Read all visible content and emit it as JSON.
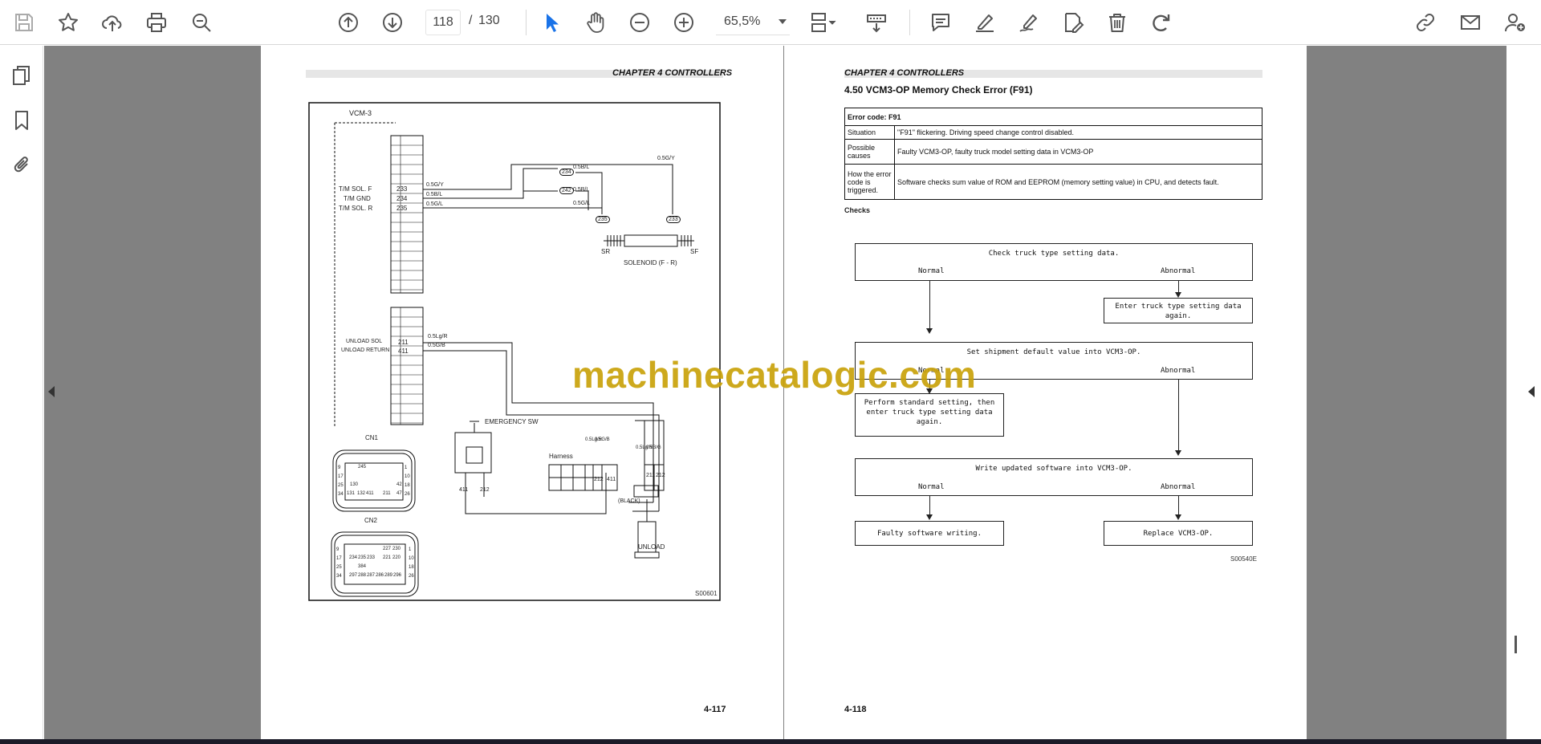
{
  "toolbar": {
    "page_current": "118",
    "page_separator": "/",
    "page_total": "130",
    "zoom": "65,5%",
    "accent": "#1a73e8",
    "icon_color": "#555555"
  },
  "sidebar": {
    "items": [
      "pages-icon",
      "bookmark-icon",
      "attachment-icon"
    ]
  },
  "left_page": {
    "chapter": "CHAPTER 4  CONTROLLERS",
    "page_number": "4-117",
    "figure_code": "S00601",
    "diagram": {
      "connector_label": "VCM-3",
      "rows1": [
        {
          "label": "T/M SOL. F",
          "pin": "233",
          "wire": "0.5G/Y"
        },
        {
          "label": "T/M GND",
          "pin": "234",
          "wire": "0.5B/L"
        },
        {
          "label": "T/M SOL. R",
          "pin": "235",
          "wire": "0.5G/L"
        }
      ],
      "top_wires": [
        "0.5G/Y",
        "0.5B/L",
        "0.5B/L",
        "0.5G/L"
      ],
      "top_pins": [
        "234",
        "242",
        "235",
        "233"
      ],
      "sr": "SR",
      "sf": "SF",
      "solenoid": "SOLENOID (F - R)",
      "rows2": [
        {
          "label": "UNLOAD SOL",
          "pin": "211",
          "wire": "0.5Lg/R"
        },
        {
          "label": "UNLOAD RETURN",
          "pin": "411",
          "wire": "0.5G/B"
        }
      ],
      "emergency": "EMERGENCY SW",
      "harness": "Harness",
      "harness_pins": [
        "212",
        "411"
      ],
      "em_pins": [
        "411",
        "212"
      ],
      "vert_wires": [
        "0.5Lg/R",
        "0.5G/B",
        "0.5Lg/R",
        "0.5B/G"
      ],
      "unload_pins": [
        "211",
        "212"
      ],
      "black": "(BLACK)",
      "unload": "UNLOAD",
      "cn1": "CN1",
      "cn2": "CN2",
      "cn1_left": [
        "9",
        "17",
        "25",
        "34"
      ],
      "cn1_right": [
        "1",
        "10",
        "18",
        "26"
      ],
      "cn1_cells": [
        "245",
        "130",
        "131",
        "132",
        "411",
        "211",
        "42",
        "47"
      ],
      "cn2_left": [
        "9",
        "17",
        "25",
        "34"
      ],
      "cn2_right": [
        "1",
        "10",
        "18",
        "26"
      ],
      "cn2_cells": [
        "234",
        "235",
        "233",
        "384",
        "227",
        "230",
        "221",
        "220",
        "288",
        "287",
        "286",
        "289",
        "296",
        "297"
      ]
    }
  },
  "right_page": {
    "chapter": "CHAPTER 4  CONTROLLERS",
    "section": "4.50    VCM3-OP Memory Check Error (F91)",
    "table": {
      "head": "Error code:  F91",
      "rows": [
        {
          "k": "Situation",
          "v": "\"F91\" flickering. Driving speed change control disabled."
        },
        {
          "k": "Possible causes",
          "v": "Faulty VCM3-OP, faulty truck model setting data in VCM3-OP"
        },
        {
          "k": "How the error code is triggered.",
          "v": "Software checks sum value of ROM and EEPROM (memory setting value) in CPU, and detects fault."
        }
      ]
    },
    "checks": "Checks",
    "flow": {
      "box1": "Check truck type setting data.",
      "box2": "Enter truck type setting data again.",
      "box3": "Set shipment default value into VCM3-OP.",
      "box4": "Perform standard setting, then enter truck type setting data again.",
      "box5": "Write updated software into VCM3-OP.",
      "box6": "Faulty software writing.",
      "box7": "Replace VCM3-OP.",
      "normal": "Normal",
      "abnormal": "Abnormal"
    },
    "figure_code": "S00540E",
    "page_number": "4-118"
  },
  "watermark": "machinecatalogic.com"
}
